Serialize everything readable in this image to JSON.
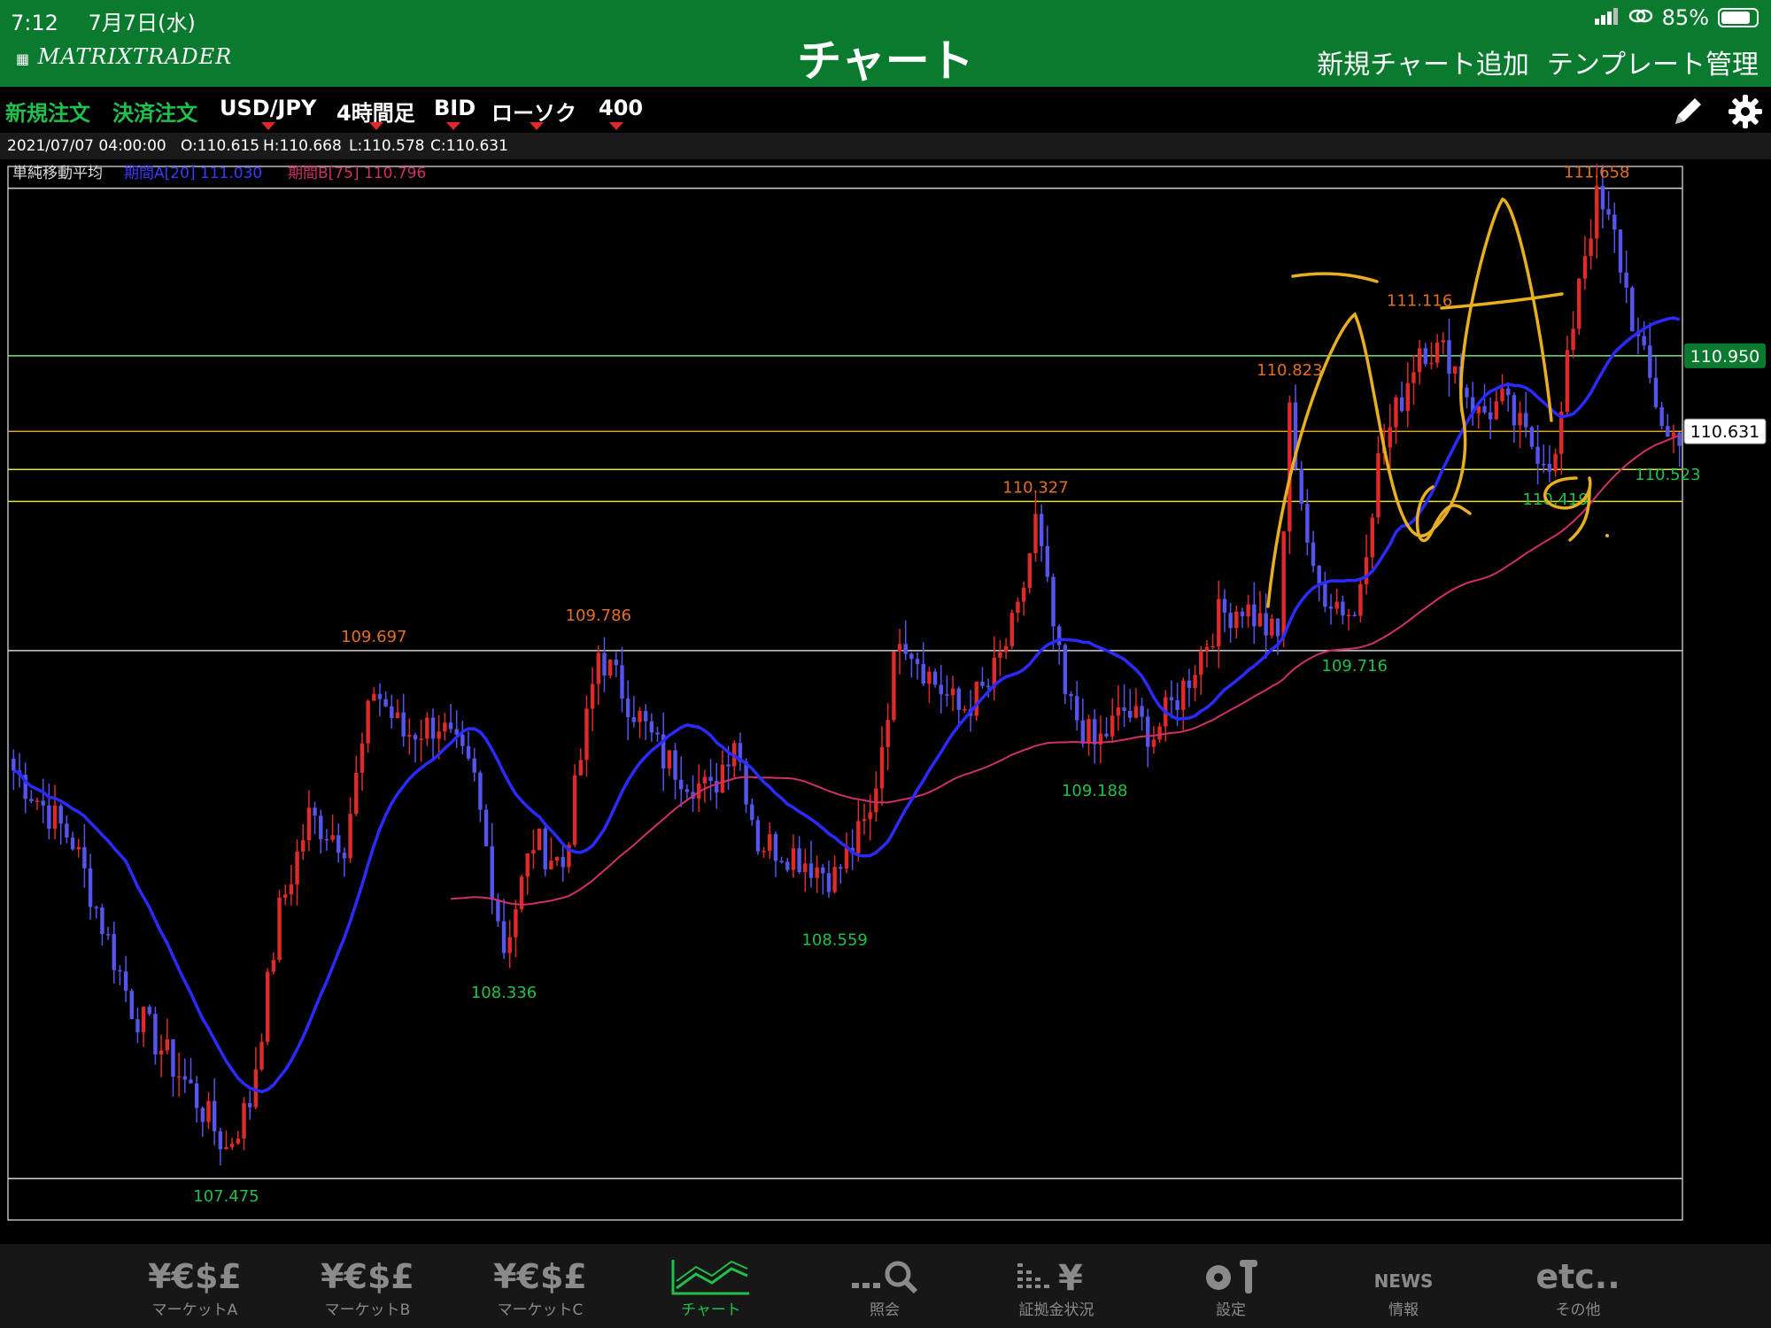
{
  "status_bar": {
    "time": "7:12",
    "date": "7月7日(水)",
    "battery_text": "85%",
    "battery_level": 0.85
  },
  "nav": {
    "logo": "MATRIXTRADER",
    "title": "チャート",
    "add_chart": "新規チャート追加",
    "template": "テンプレート管理"
  },
  "toolbar": {
    "new_order": "新規注文",
    "settle_order": "決済注文",
    "pair": "USD/JPY",
    "timeframe": "4時間足",
    "price_type": "BID",
    "chart_type": "ローソク",
    "count": "400"
  },
  "ohlc": {
    "datetime": "2021/07/07 04:00:00",
    "open": "O:110.615",
    "high": "H:110.668",
    "low": "L:110.578",
    "close": "C:110.631"
  },
  "indicator": {
    "name": "単純移動平均",
    "ma_a": "期間A[20] 111.030",
    "ma_b": "期間B[75] 110.796"
  },
  "colors": {
    "green": "#0a7a2e",
    "up": "#e02a2a",
    "down": "#5555ee",
    "ma_a": "#2b2bff",
    "ma_b": "#d0306a",
    "high_label": "#e07020",
    "low_label": "#21c04a",
    "annot": "#e8b020"
  },
  "chart_data": {
    "type": "candlestick",
    "symbol": "USD/JPY",
    "timeframe": "4時間足",
    "ylim": [
      107.3,
      111.75
    ],
    "right_axis_labels": [
      {
        "value": 110.95,
        "text": "110.950"
      },
      {
        "value": 110.631,
        "text": "110.631"
      }
    ],
    "horizontal_lines": [
      111.658,
      110.95,
      110.631,
      110.47,
      110.335,
      109.705,
      107.475
    ],
    "peak_labels": [
      {
        "text": "109.697",
        "value": 109.697,
        "index": 61
      },
      {
        "text": "109.786",
        "value": 109.786,
        "index": 99
      },
      {
        "text": "110.327",
        "value": 110.327,
        "index": 173
      },
      {
        "text": "110.823",
        "value": 110.823,
        "index": 216
      },
      {
        "text": "111.116",
        "value": 111.116,
        "index": 238
      },
      {
        "text": "111.658",
        "value": 111.658,
        "index": 268
      }
    ],
    "trough_labels": [
      {
        "text": "107.475",
        "value": 107.475,
        "index": 36
      },
      {
        "text": "108.336",
        "value": 108.336,
        "index": 83
      },
      {
        "text": "108.559",
        "value": 108.559,
        "index": 139
      },
      {
        "text": "109.188",
        "value": 109.188,
        "index": 183
      },
      {
        "text": "109.716",
        "value": 109.716,
        "index": 227
      },
      {
        "text": "110.419",
        "value": 110.419,
        "index": 261
      },
      {
        "text": "110.523",
        "value": 110.523,
        "index": 280
      }
    ],
    "key_points": [
      [
        0,
        109.2
      ],
      [
        10,
        108.9
      ],
      [
        20,
        108.2
      ],
      [
        30,
        107.85
      ],
      [
        36,
        107.6
      ],
      [
        40,
        107.8
      ],
      [
        45,
        108.6
      ],
      [
        50,
        109.0
      ],
      [
        56,
        108.9
      ],
      [
        61,
        109.55
      ],
      [
        66,
        109.35
      ],
      [
        72,
        109.4
      ],
      [
        78,
        109.15
      ],
      [
        83,
        108.45
      ],
      [
        88,
        108.9
      ],
      [
        93,
        108.8
      ],
      [
        99,
        109.7
      ],
      [
        104,
        109.5
      ],
      [
        110,
        109.25
      ],
      [
        118,
        109.1
      ],
      [
        122,
        109.35
      ],
      [
        126,
        108.9
      ],
      [
        132,
        108.85
      ],
      [
        139,
        108.75
      ],
      [
        145,
        109.0
      ],
      [
        150,
        109.8
      ],
      [
        155,
        109.6
      ],
      [
        160,
        109.45
      ],
      [
        165,
        109.55
      ],
      [
        170,
        109.85
      ],
      [
        173,
        110.25
      ],
      [
        178,
        109.5
      ],
      [
        183,
        109.3
      ],
      [
        188,
        109.45
      ],
      [
        193,
        109.35
      ],
      [
        198,
        109.55
      ],
      [
        204,
        109.85
      ],
      [
        208,
        109.9
      ],
      [
        214,
        109.75
      ],
      [
        216,
        110.7
      ],
      [
        220,
        110.0
      ],
      [
        227,
        109.85
      ],
      [
        231,
        110.5
      ],
      [
        236,
        110.85
      ],
      [
        238,
        111.0
      ],
      [
        243,
        110.95
      ],
      [
        248,
        110.7
      ],
      [
        252,
        110.75
      ],
      [
        256,
        110.6
      ],
      [
        261,
        110.5
      ],
      [
        265,
        111.3
      ],
      [
        268,
        111.6
      ],
      [
        271,
        111.45
      ],
      [
        275,
        111.0
      ],
      [
        280,
        110.6
      ],
      [
        282,
        110.63
      ]
    ]
  }
}
